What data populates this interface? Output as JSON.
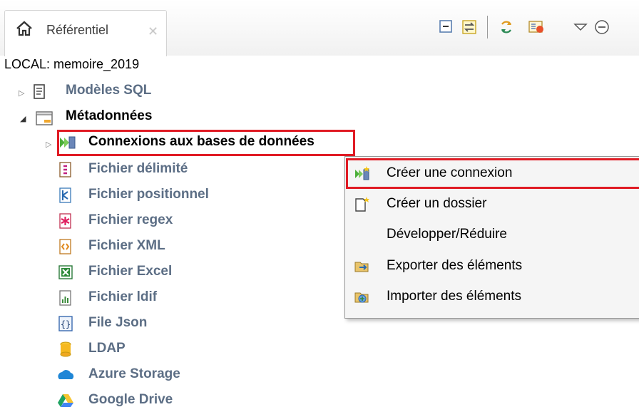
{
  "tab": {
    "label": "Référentiel"
  },
  "repo": {
    "label": "LOCAL: memoire_2019"
  },
  "tree": [
    {
      "label": "Modèles SQL",
      "icon": "sql-template-icon"
    },
    {
      "label": "Métadonnées",
      "icon": "metadata-folder-icon"
    },
    {
      "label": "Connexions aux bases de données",
      "icon": "db-connection-icon"
    },
    {
      "label": "Fichier délimité",
      "icon": "delimited-file-icon"
    },
    {
      "label": "Fichier positionnel",
      "icon": "positional-file-icon"
    },
    {
      "label": "Fichier regex",
      "icon": "regex-file-icon"
    },
    {
      "label": "Fichier XML",
      "icon": "xml-file-icon"
    },
    {
      "label": "Fichier Excel",
      "icon": "excel-file-icon"
    },
    {
      "label": "Fichier ldif",
      "icon": "ldif-file-icon"
    },
    {
      "label": "File Json",
      "icon": "json-file-icon"
    },
    {
      "label": "LDAP",
      "icon": "ldap-icon"
    },
    {
      "label": "Azure Storage",
      "icon": "azure-storage-icon"
    },
    {
      "label": "Google Drive",
      "icon": "google-drive-icon"
    }
  ],
  "context_menu": [
    {
      "label": "Créer une connexion",
      "icon": "create-connection-icon"
    },
    {
      "label": "Créer un dossier",
      "icon": "create-folder-icon"
    },
    {
      "label": "Développer/Réduire",
      "icon": ""
    },
    {
      "label": "Exporter des éléments",
      "icon": "export-icon"
    },
    {
      "label": "Importer des éléments",
      "icon": "import-icon"
    }
  ],
  "colors": {
    "highlight": "#e01b24",
    "tree_text": "#5c6e85"
  }
}
